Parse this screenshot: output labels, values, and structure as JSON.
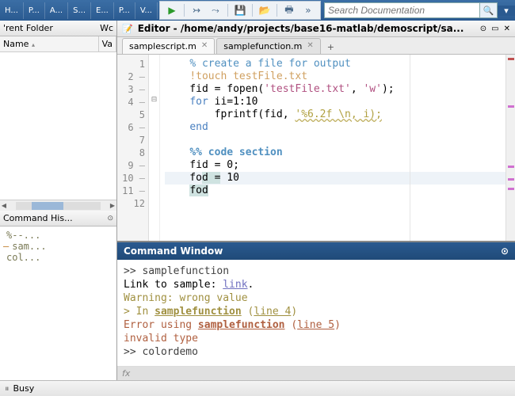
{
  "toolbar": {
    "tabs": [
      "H...",
      "P...",
      "A...",
      "S...",
      "E...",
      "P...",
      "V..."
    ],
    "search_placeholder": "Search Documentation"
  },
  "current_folder": {
    "title": "'rent Folder",
    "wc": "Wc",
    "cols": {
      "name": "Name",
      "value": "Va"
    }
  },
  "history": {
    "title": "Command His...",
    "items": [
      "%--...",
      "sam...",
      "col..."
    ]
  },
  "editor": {
    "title": "Editor - /home/andy/projects/base16-matlab/demoscript/sa...",
    "tabs": [
      {
        "label": "samplescript.m",
        "active": true
      },
      {
        "label": "samplefunction.m",
        "active": false
      }
    ],
    "lines": [
      {
        "n": 1,
        "dash": false,
        "html": "    <span class='cm'>% create a file for output</span>"
      },
      {
        "n": 2,
        "dash": true,
        "html": "    <span class='sh'>!touch testFile.txt</span>"
      },
      {
        "n": 3,
        "dash": true,
        "html": "    fid = fopen(<span class='str'>'testFile.txt'</span>, <span class='str'>'w'</span>);"
      },
      {
        "n": 4,
        "dash": true,
        "html": "    <span class='kw'>for</span> ii=1:10",
        "fold": "⊟"
      },
      {
        "n": 5,
        "dash": false,
        "html": "        fprintf(fid, <span class='warn'>'%6.2f \\n, i);</span>"
      },
      {
        "n": 6,
        "dash": true,
        "html": "    <span class='kw'>end</span>"
      },
      {
        "n": 7,
        "dash": false,
        "html": "    "
      },
      {
        "n": 8,
        "dash": false,
        "html": "    <span class='sect'>%% code section</span>"
      },
      {
        "n": 9,
        "dash": true,
        "html": "    fid = 0;"
      },
      {
        "n": 10,
        "dash": true,
        "html": "    fo<span class='sel'>d =</span> 10",
        "hl": true
      },
      {
        "n": 11,
        "dash": true,
        "html": "    <span class='sel'>fod</span>"
      },
      {
        "n": 12,
        "dash": false,
        "html": ""
      }
    ]
  },
  "command_window": {
    "title": "Command Window",
    "lines": [
      {
        "html": "<span class='prompt'>&gt;&gt; samplefunction</span>"
      },
      {
        "html": "Link to sample: <a href='#'>link</a>."
      },
      {
        "html": "<span class='wt'>Warning: wrong value</span>"
      },
      {
        "html": "<span class='wt'>&gt; In <b><u>samplefunction</u></b> (<u>line 4</u>)</span>"
      },
      {
        "html": "<span class='er'>Error using <b><u>samplefunction</u></b> (<u>line 5</u>)</span>"
      },
      {
        "html": "<span class='er'>invalid type</span>"
      },
      {
        "html": "<span class='prompt'>&gt;&gt; colordemo</span>"
      }
    ],
    "fx": "fx"
  },
  "status": {
    "text": "Busy"
  }
}
